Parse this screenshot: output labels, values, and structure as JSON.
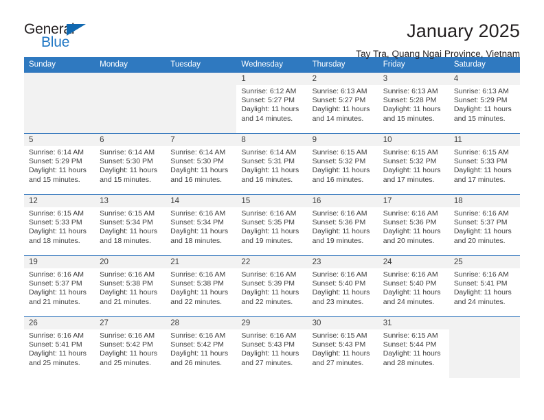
{
  "logo": {
    "word1": "General",
    "word2": "Blue",
    "triangle_color": "#1068b0",
    "blue_color": "#2077c4"
  },
  "header": {
    "title": "January 2025",
    "subtitle": "Tay Tra, Quang Ngai Province, Vietnam"
  },
  "theme": {
    "header_bg": "#2f79c0",
    "grid_line": "#3c7cbf",
    "daynum_bg": "#f2f2f2",
    "text": "#3b3b3b"
  },
  "weekday_headers": [
    "Sunday",
    "Monday",
    "Tuesday",
    "Wednesday",
    "Thursday",
    "Friday",
    "Saturday"
  ],
  "labels": {
    "sunrise": "Sunrise:",
    "sunset": "Sunset:",
    "daylight": "Daylight:"
  },
  "weeks": [
    [
      {
        "day": "",
        "blank": true
      },
      {
        "day": "",
        "blank": true
      },
      {
        "day": "",
        "blank": true
      },
      {
        "day": "1",
        "sunrise": "Sunrise: 6:12 AM",
        "sunset": "Sunset: 5:27 PM",
        "daylight": "Daylight: 11 hours and 14 minutes."
      },
      {
        "day": "2",
        "sunrise": "Sunrise: 6:13 AM",
        "sunset": "Sunset: 5:27 PM",
        "daylight": "Daylight: 11 hours and 14 minutes."
      },
      {
        "day": "3",
        "sunrise": "Sunrise: 6:13 AM",
        "sunset": "Sunset: 5:28 PM",
        "daylight": "Daylight: 11 hours and 15 minutes."
      },
      {
        "day": "4",
        "sunrise": "Sunrise: 6:13 AM",
        "sunset": "Sunset: 5:29 PM",
        "daylight": "Daylight: 11 hours and 15 minutes."
      }
    ],
    [
      {
        "day": "5",
        "sunrise": "Sunrise: 6:14 AM",
        "sunset": "Sunset: 5:29 PM",
        "daylight": "Daylight: 11 hours and 15 minutes."
      },
      {
        "day": "6",
        "sunrise": "Sunrise: 6:14 AM",
        "sunset": "Sunset: 5:30 PM",
        "daylight": "Daylight: 11 hours and 15 minutes."
      },
      {
        "day": "7",
        "sunrise": "Sunrise: 6:14 AM",
        "sunset": "Sunset: 5:30 PM",
        "daylight": "Daylight: 11 hours and 16 minutes."
      },
      {
        "day": "8",
        "sunrise": "Sunrise: 6:14 AM",
        "sunset": "Sunset: 5:31 PM",
        "daylight": "Daylight: 11 hours and 16 minutes."
      },
      {
        "day": "9",
        "sunrise": "Sunrise: 6:15 AM",
        "sunset": "Sunset: 5:32 PM",
        "daylight": "Daylight: 11 hours and 16 minutes."
      },
      {
        "day": "10",
        "sunrise": "Sunrise: 6:15 AM",
        "sunset": "Sunset: 5:32 PM",
        "daylight": "Daylight: 11 hours and 17 minutes."
      },
      {
        "day": "11",
        "sunrise": "Sunrise: 6:15 AM",
        "sunset": "Sunset: 5:33 PM",
        "daylight": "Daylight: 11 hours and 17 minutes."
      }
    ],
    [
      {
        "day": "12",
        "sunrise": "Sunrise: 6:15 AM",
        "sunset": "Sunset: 5:33 PM",
        "daylight": "Daylight: 11 hours and 18 minutes."
      },
      {
        "day": "13",
        "sunrise": "Sunrise: 6:15 AM",
        "sunset": "Sunset: 5:34 PM",
        "daylight": "Daylight: 11 hours and 18 minutes."
      },
      {
        "day": "14",
        "sunrise": "Sunrise: 6:16 AM",
        "sunset": "Sunset: 5:34 PM",
        "daylight": "Daylight: 11 hours and 18 minutes."
      },
      {
        "day": "15",
        "sunrise": "Sunrise: 6:16 AM",
        "sunset": "Sunset: 5:35 PM",
        "daylight": "Daylight: 11 hours and 19 minutes."
      },
      {
        "day": "16",
        "sunrise": "Sunrise: 6:16 AM",
        "sunset": "Sunset: 5:36 PM",
        "daylight": "Daylight: 11 hours and 19 minutes."
      },
      {
        "day": "17",
        "sunrise": "Sunrise: 6:16 AM",
        "sunset": "Sunset: 5:36 PM",
        "daylight": "Daylight: 11 hours and 20 minutes."
      },
      {
        "day": "18",
        "sunrise": "Sunrise: 6:16 AM",
        "sunset": "Sunset: 5:37 PM",
        "daylight": "Daylight: 11 hours and 20 minutes."
      }
    ],
    [
      {
        "day": "19",
        "sunrise": "Sunrise: 6:16 AM",
        "sunset": "Sunset: 5:37 PM",
        "daylight": "Daylight: 11 hours and 21 minutes."
      },
      {
        "day": "20",
        "sunrise": "Sunrise: 6:16 AM",
        "sunset": "Sunset: 5:38 PM",
        "daylight": "Daylight: 11 hours and 21 minutes."
      },
      {
        "day": "21",
        "sunrise": "Sunrise: 6:16 AM",
        "sunset": "Sunset: 5:38 PM",
        "daylight": "Daylight: 11 hours and 22 minutes."
      },
      {
        "day": "22",
        "sunrise": "Sunrise: 6:16 AM",
        "sunset": "Sunset: 5:39 PM",
        "daylight": "Daylight: 11 hours and 22 minutes."
      },
      {
        "day": "23",
        "sunrise": "Sunrise: 6:16 AM",
        "sunset": "Sunset: 5:40 PM",
        "daylight": "Daylight: 11 hours and 23 minutes."
      },
      {
        "day": "24",
        "sunrise": "Sunrise: 6:16 AM",
        "sunset": "Sunset: 5:40 PM",
        "daylight": "Daylight: 11 hours and 24 minutes."
      },
      {
        "day": "25",
        "sunrise": "Sunrise: 6:16 AM",
        "sunset": "Sunset: 5:41 PM",
        "daylight": "Daylight: 11 hours and 24 minutes."
      }
    ],
    [
      {
        "day": "26",
        "sunrise": "Sunrise: 6:16 AM",
        "sunset": "Sunset: 5:41 PM",
        "daylight": "Daylight: 11 hours and 25 minutes."
      },
      {
        "day": "27",
        "sunrise": "Sunrise: 6:16 AM",
        "sunset": "Sunset: 5:42 PM",
        "daylight": "Daylight: 11 hours and 25 minutes."
      },
      {
        "day": "28",
        "sunrise": "Sunrise: 6:16 AM",
        "sunset": "Sunset: 5:42 PM",
        "daylight": "Daylight: 11 hours and 26 minutes."
      },
      {
        "day": "29",
        "sunrise": "Sunrise: 6:16 AM",
        "sunset": "Sunset: 5:43 PM",
        "daylight": "Daylight: 11 hours and 27 minutes."
      },
      {
        "day": "30",
        "sunrise": "Sunrise: 6:15 AM",
        "sunset": "Sunset: 5:43 PM",
        "daylight": "Daylight: 11 hours and 27 minutes."
      },
      {
        "day": "31",
        "sunrise": "Sunrise: 6:15 AM",
        "sunset": "Sunset: 5:44 PM",
        "daylight": "Daylight: 11 hours and 28 minutes."
      },
      {
        "day": "",
        "blank": true
      }
    ]
  ]
}
